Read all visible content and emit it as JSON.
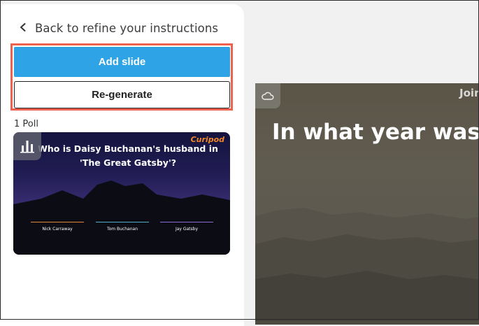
{
  "sidebar": {
    "back_label": "Back to refine your instructions",
    "add_slide_label": "Add slide",
    "regenerate_label": "Re-generate",
    "slide_count": "1 Poll",
    "slide_card": {
      "question": "Who is Daisy Buchanan's husband in 'The Great Gatsby'?",
      "logo": "Curipod",
      "options": [
        "Nick Carraway",
        "Tom Buchanan",
        "Jay Gatsby"
      ]
    }
  },
  "preview": {
    "join_label": "Join",
    "question": "In what year was T"
  },
  "colors": {
    "accent": "#2ea3e6",
    "highlight": "#f0604f",
    "option_colors": [
      "#e0883a",
      "#4fb0c7",
      "#8e6bd8"
    ]
  },
  "icons": {
    "back": "chevron-left-icon",
    "poll": "poll-bar-chart-icon",
    "cloud": "cloud-icon"
  }
}
